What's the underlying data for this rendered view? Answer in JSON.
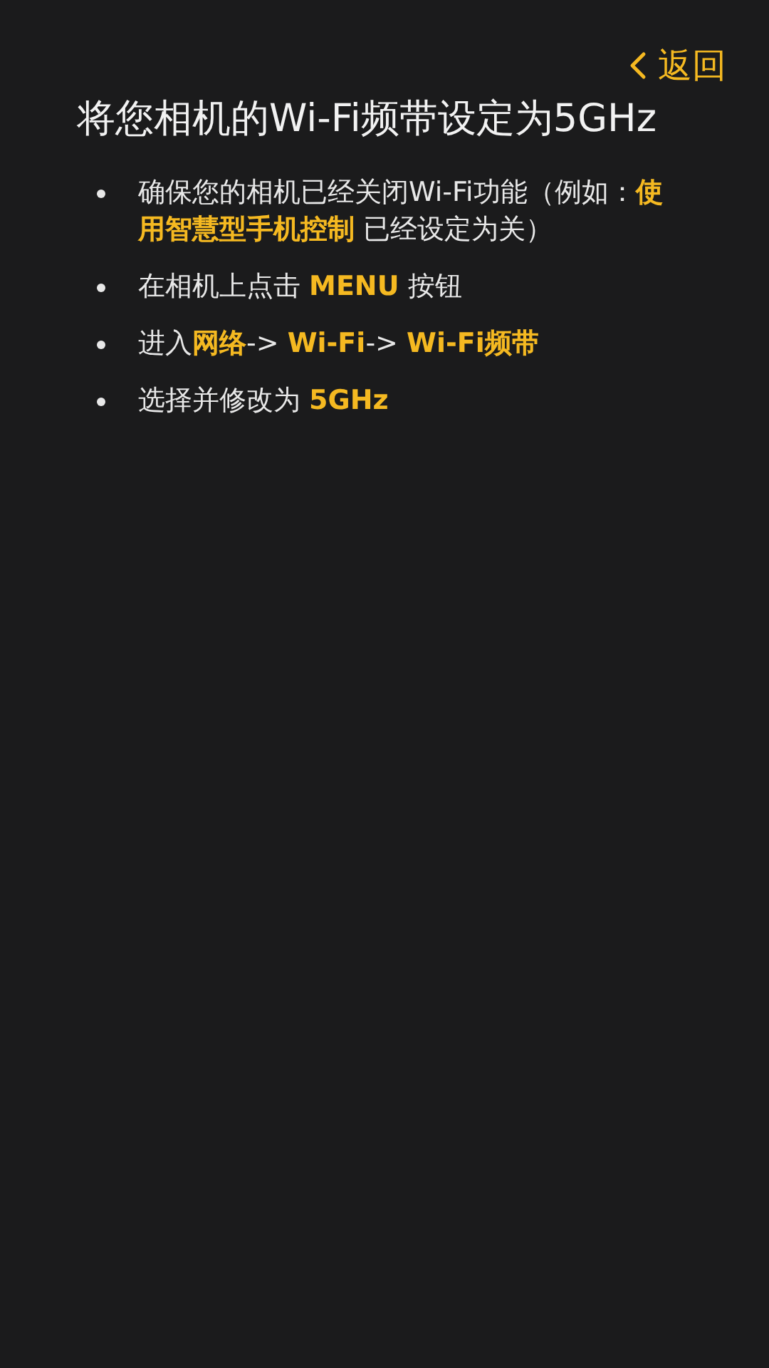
{
  "back_button": {
    "label": "返回"
  },
  "title": "将您相机的Wi-Fi频带设定为5GHz",
  "steps": [
    {
      "text": "确保您的相机已经关闭Wi-Fi功能（例如：**使用智慧型手机控制** 已经设定为关）"
    },
    {
      "text": "在相机上点击 **MENU** 按钮"
    },
    {
      "text": "进入**网络**-> **Wi-Fi**-> **Wi-Fi频带**"
    },
    {
      "text": "选择并修改为 **5GHz**"
    }
  ]
}
